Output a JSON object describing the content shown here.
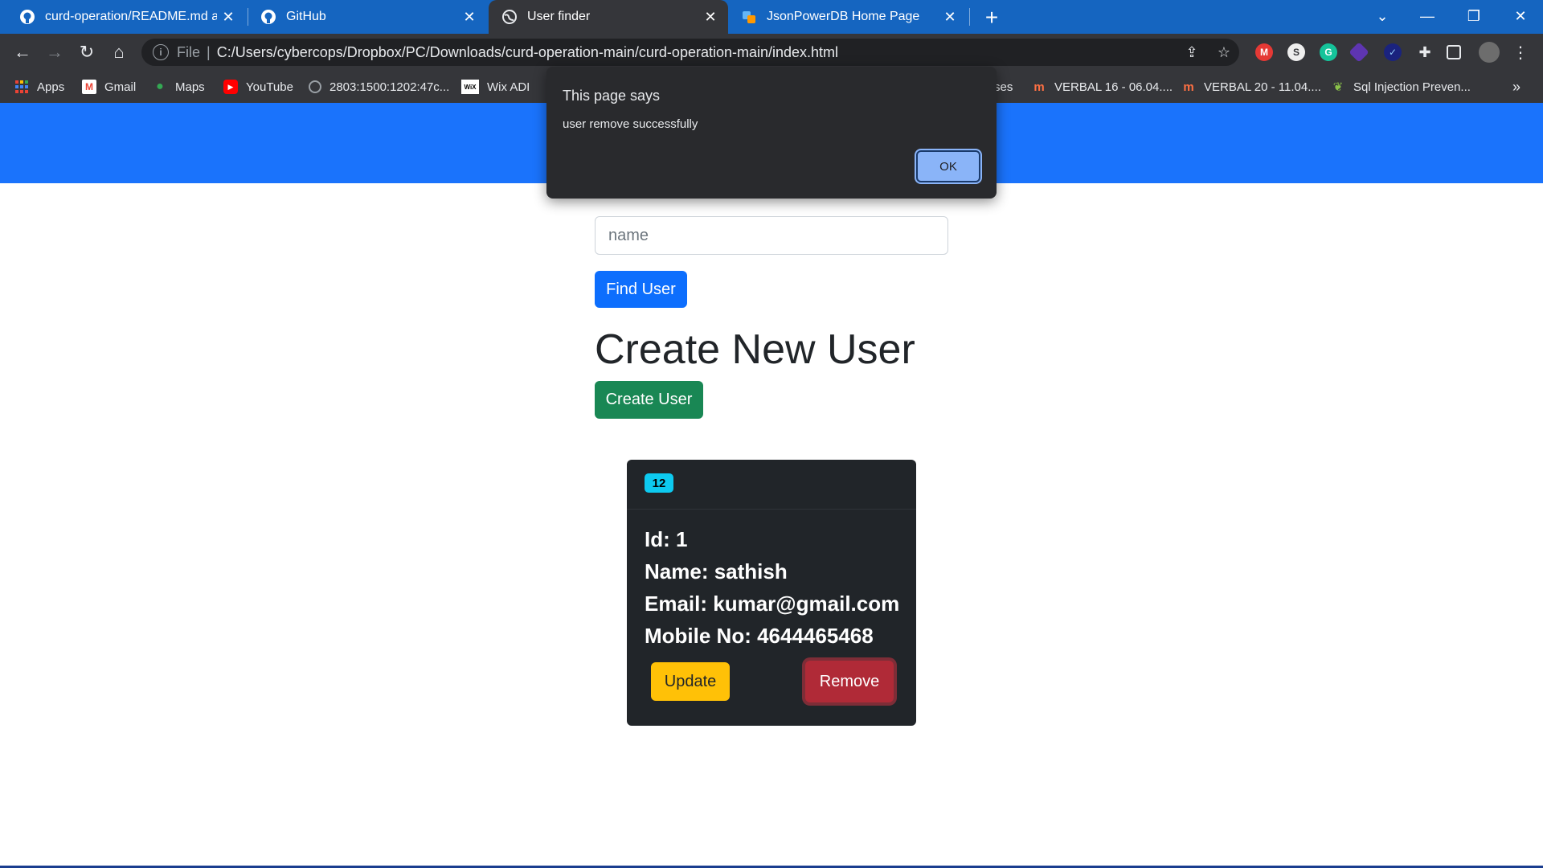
{
  "browser": {
    "tabs": [
      {
        "title": "curd-operation/README.md at m",
        "icon": "github-icon"
      },
      {
        "title": "GitHub",
        "icon": "github-icon"
      },
      {
        "title": "User finder",
        "icon": "globe-icon",
        "active": true
      },
      {
        "title": "JsonPowerDB Home Page",
        "icon": "jpdb-icon"
      }
    ],
    "address": {
      "scheme_label": "File",
      "url": "C:/Users/cybercops/Dropbox/PC/Downloads/curd-operation-main/curd-operation-main/index.html"
    },
    "bookmarks": [
      {
        "label": "Apps",
        "icon": "apps-grid-icon"
      },
      {
        "label": "Gmail",
        "icon": "gmail-icon"
      },
      {
        "label": "Maps",
        "icon": "maps-pin-icon"
      },
      {
        "label": "YouTube",
        "icon": "youtube-icon"
      },
      {
        "label": "2803:1500:1202:47c...",
        "icon": "globe-icon"
      },
      {
        "label": "Wix ADI",
        "icon": "wix-icon"
      },
      {
        "label": "rses",
        "icon": ""
      },
      {
        "label": "VERBAL 16 - 06.04....",
        "icon": "m-logo-icon"
      },
      {
        "label": "VERBAL 20 - 11.04....",
        "icon": "m-logo-icon"
      },
      {
        "label": "Sql Injection Preven...",
        "icon": "leaf-icon"
      }
    ],
    "more_bookmarks": "»"
  },
  "page": {
    "header_color": "#1a73fc",
    "search_placeholder": "name",
    "find_button": "Find User",
    "heading": "Create New User",
    "create_button": "Create User",
    "card": {
      "badge": "12",
      "id_line": "Id: 1",
      "name_line": "Name: sathish",
      "email_line": "Email: kumar@gmail.com",
      "mobile_line": "Mobile No: 4644465468",
      "update_button": "Update",
      "remove_button": "Remove"
    }
  },
  "dialog": {
    "title": "This page says",
    "message": "user remove successfully",
    "ok_button": "OK"
  }
}
